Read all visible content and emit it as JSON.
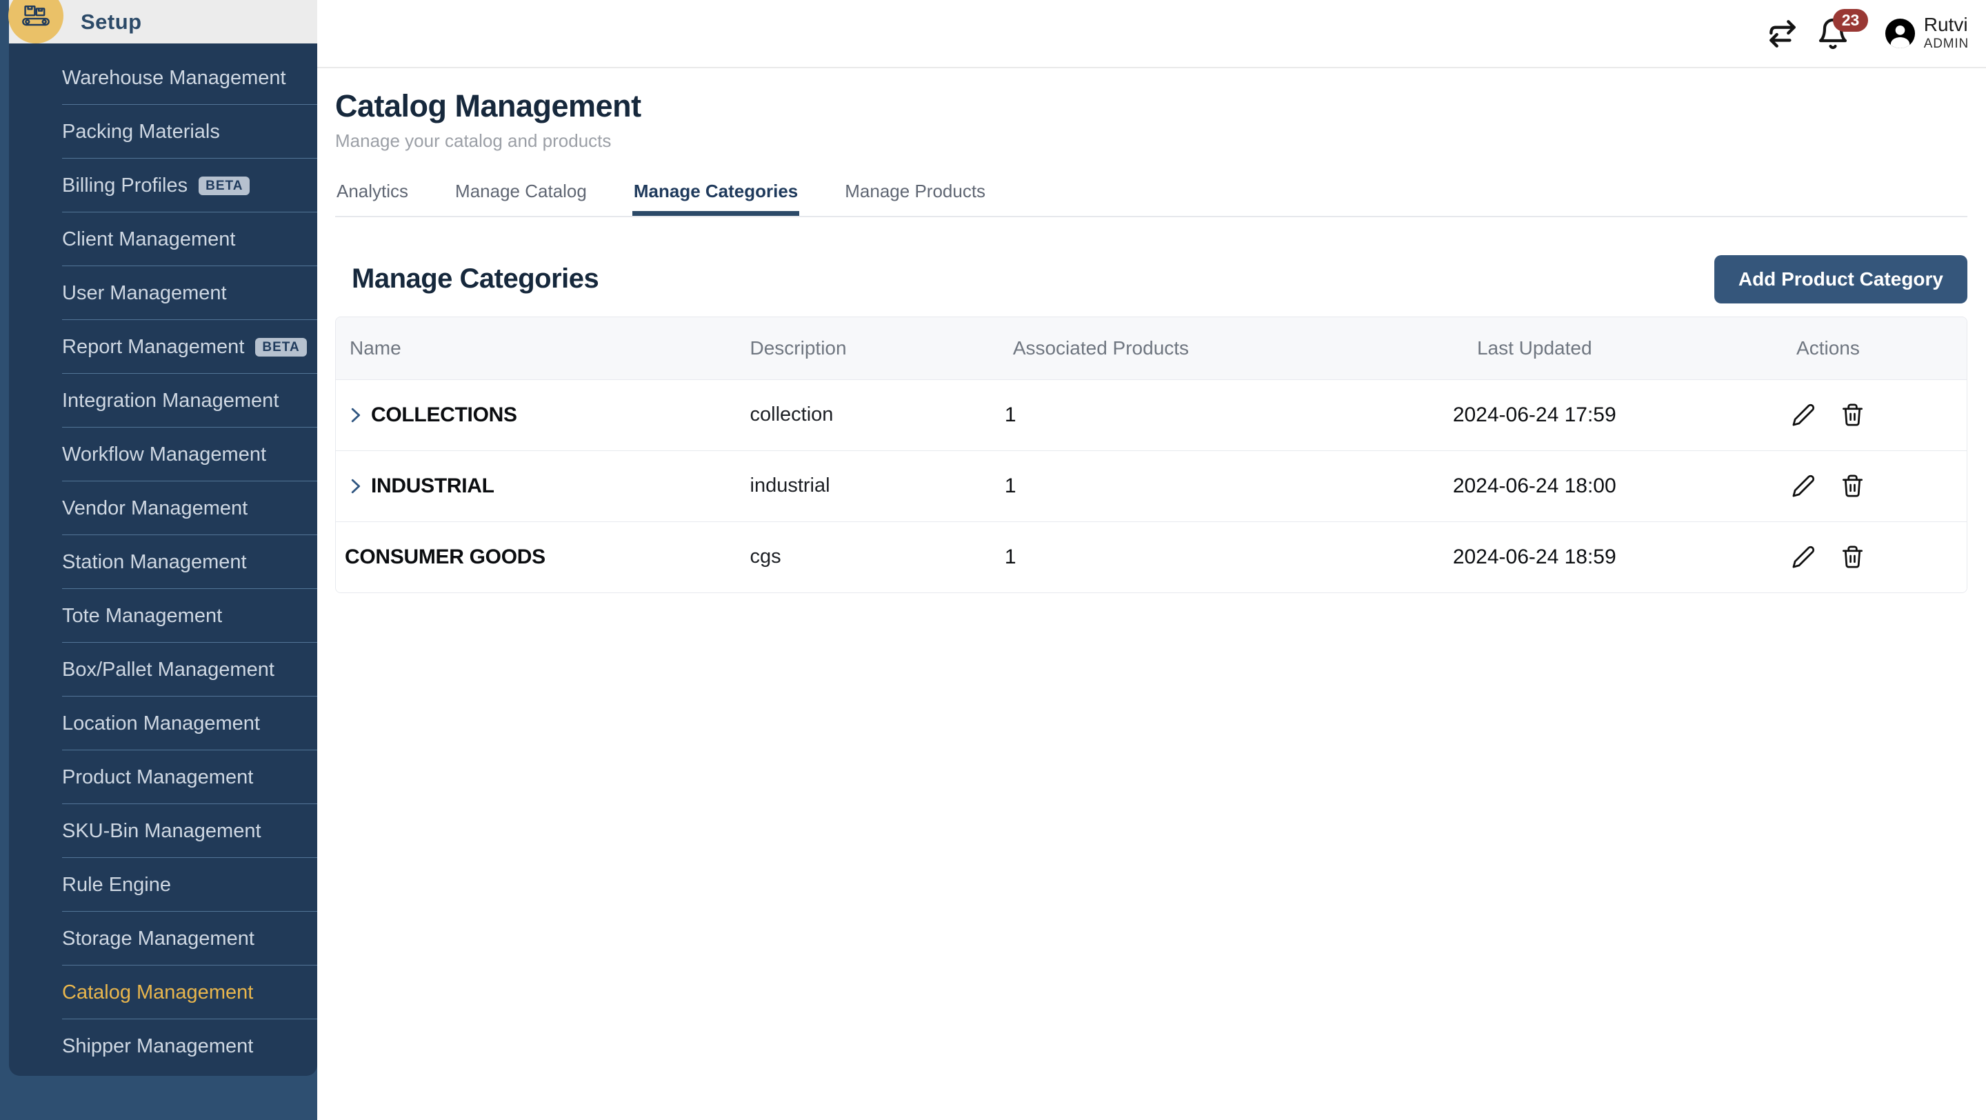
{
  "sidebar": {
    "header": {
      "label": "Setup"
    },
    "items": [
      {
        "label": "Warehouse Management"
      },
      {
        "label": "Packing Materials"
      },
      {
        "label": "Billing Profiles",
        "badge": "BETA"
      },
      {
        "label": "Client Management"
      },
      {
        "label": "User Management"
      },
      {
        "label": "Report Management",
        "badge": "BETA"
      },
      {
        "label": "Integration Management"
      },
      {
        "label": "Workflow Management"
      },
      {
        "label": "Vendor Management"
      },
      {
        "label": "Station Management"
      },
      {
        "label": "Tote Management"
      },
      {
        "label": "Box/Pallet Management"
      },
      {
        "label": "Location Management"
      },
      {
        "label": "Product Management"
      },
      {
        "label": "SKU-Bin Management"
      },
      {
        "label": "Rule Engine"
      },
      {
        "label": "Storage Management"
      },
      {
        "label": "Catalog Management",
        "active": true
      },
      {
        "label": "Shipper Management"
      }
    ]
  },
  "topbar": {
    "notifications_count": "23",
    "user": {
      "name": "Rutvi",
      "role": "ADMIN"
    }
  },
  "page": {
    "title": "Catalog Management",
    "subtitle": "Manage your catalog and products",
    "tabs": [
      {
        "label": "Analytics"
      },
      {
        "label": "Manage Catalog"
      },
      {
        "label": "Manage Categories",
        "active": true
      },
      {
        "label": "Manage Products"
      }
    ]
  },
  "section": {
    "title": "Manage Categories",
    "add_button": "Add Product Category"
  },
  "table": {
    "columns": [
      "Name",
      "Description",
      "Associated Products",
      "Last Updated",
      "Actions"
    ],
    "rows": [
      {
        "name": "COLLECTIONS",
        "description": "collection",
        "associated_products": "1",
        "last_updated": "2024-06-24 17:59",
        "expandable": true
      },
      {
        "name": "INDUSTRIAL",
        "description": "industrial",
        "associated_products": "1",
        "last_updated": "2024-06-24 18:00",
        "expandable": true
      },
      {
        "name": "CONSUMER GOODS",
        "description": "cgs",
        "associated_products": "1",
        "last_updated": "2024-06-24 18:59",
        "expandable": false
      }
    ]
  },
  "colors": {
    "accent_navy": "#2c4a68",
    "sidebar_panel": "#213a58",
    "sidebar_outer": "#2e4f71",
    "active_gold": "#e9b64d",
    "notification_red": "#993834",
    "button_bg": "#35567b",
    "setup_circle": "#eac168"
  }
}
